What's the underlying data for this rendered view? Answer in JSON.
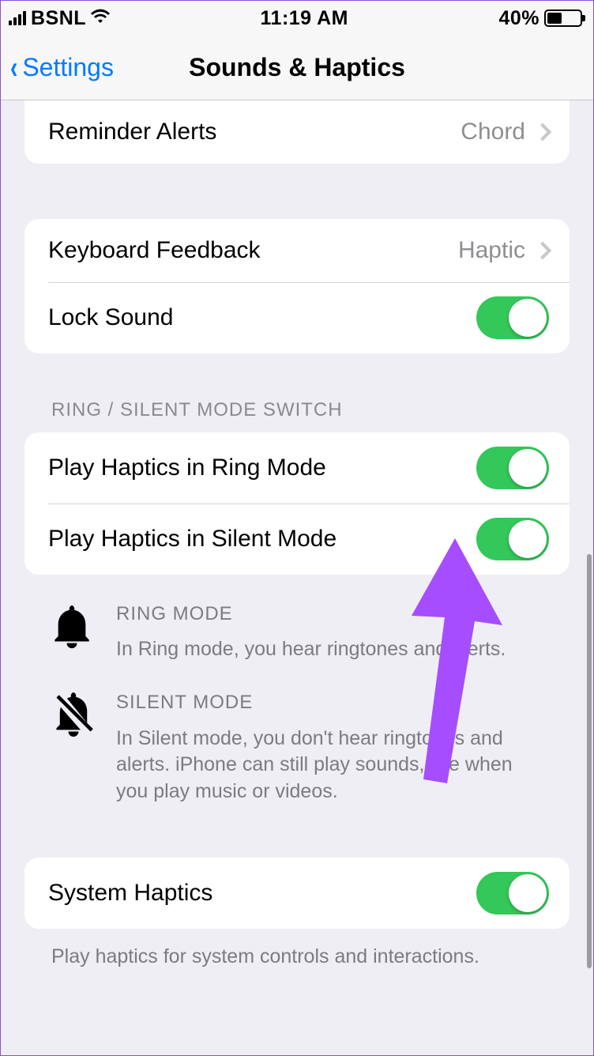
{
  "status": {
    "carrier": "BSNL",
    "time": "11:19 AM",
    "battery_pct": "40%"
  },
  "nav": {
    "back_label": "Settings",
    "title": "Sounds & Haptics"
  },
  "rows": {
    "reminder": {
      "label": "Reminder Alerts",
      "value": "Chord"
    },
    "keyboard": {
      "label": "Keyboard Feedback",
      "value": "Haptic"
    },
    "lock": {
      "label": "Lock Sound"
    },
    "ring_haptics": {
      "label": "Play Haptics in Ring Mode"
    },
    "silent_haptics": {
      "label": "Play Haptics in Silent Mode"
    },
    "system_haptics": {
      "label": "System Haptics"
    }
  },
  "headers": {
    "ring_silent_switch": "RING / SILENT MODE SWITCH"
  },
  "footers": {
    "ring_title": "RING MODE",
    "ring_body": "In Ring mode, you hear ringtones and alerts.",
    "silent_title": "SILENT MODE",
    "silent_body": "In Silent mode, you don't hear ringtones and alerts. iPhone can still play sounds, like when you play music or videos.",
    "system_haptics_note": "Play haptics for system controls and interactions."
  },
  "toggles": {
    "lock_sound": true,
    "ring_haptics": true,
    "silent_haptics": true,
    "system_haptics": true
  },
  "colors": {
    "accent_blue": "#007aff",
    "toggle_green": "#34c759",
    "annotation_purple": "#a64dff"
  }
}
